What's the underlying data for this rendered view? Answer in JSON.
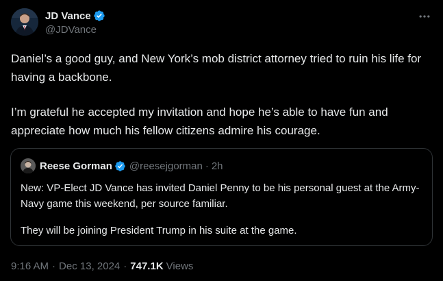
{
  "author": {
    "display_name": "JD Vance",
    "handle": "@JDVance",
    "verified_icon": "verified-badge-icon",
    "verified_color": "#1d9bf0"
  },
  "tweet": {
    "paragraph_1": "Daniel’s a good guy, and New York’s mob district attorney tried to ruin his life for having a backbone.",
    "paragraph_2": "I’m grateful he accepted my invitation and hope he’s able to have fun and appreciate how much his fellow citizens admire his courage."
  },
  "quoted_tweet": {
    "display_name": "Reese Gorman",
    "handle": "@reesejgorman",
    "dot": "·",
    "time": "2h",
    "verified_icon": "verified-badge-icon",
    "paragraph_1": "New: VP-Elect JD Vance has invited Daniel Penny to be his personal guest at the Army-Navy game this weekend, per source familiar.",
    "paragraph_2": "They will be joining President Trump in his suite at the game."
  },
  "meta": {
    "time": "9:16 AM",
    "separator_1": "·",
    "date": "Dec 13, 2024",
    "separator_2": "·",
    "views_count": "747.1K",
    "views_label": "Views"
  },
  "more_icon": "more-horizontal-icon"
}
